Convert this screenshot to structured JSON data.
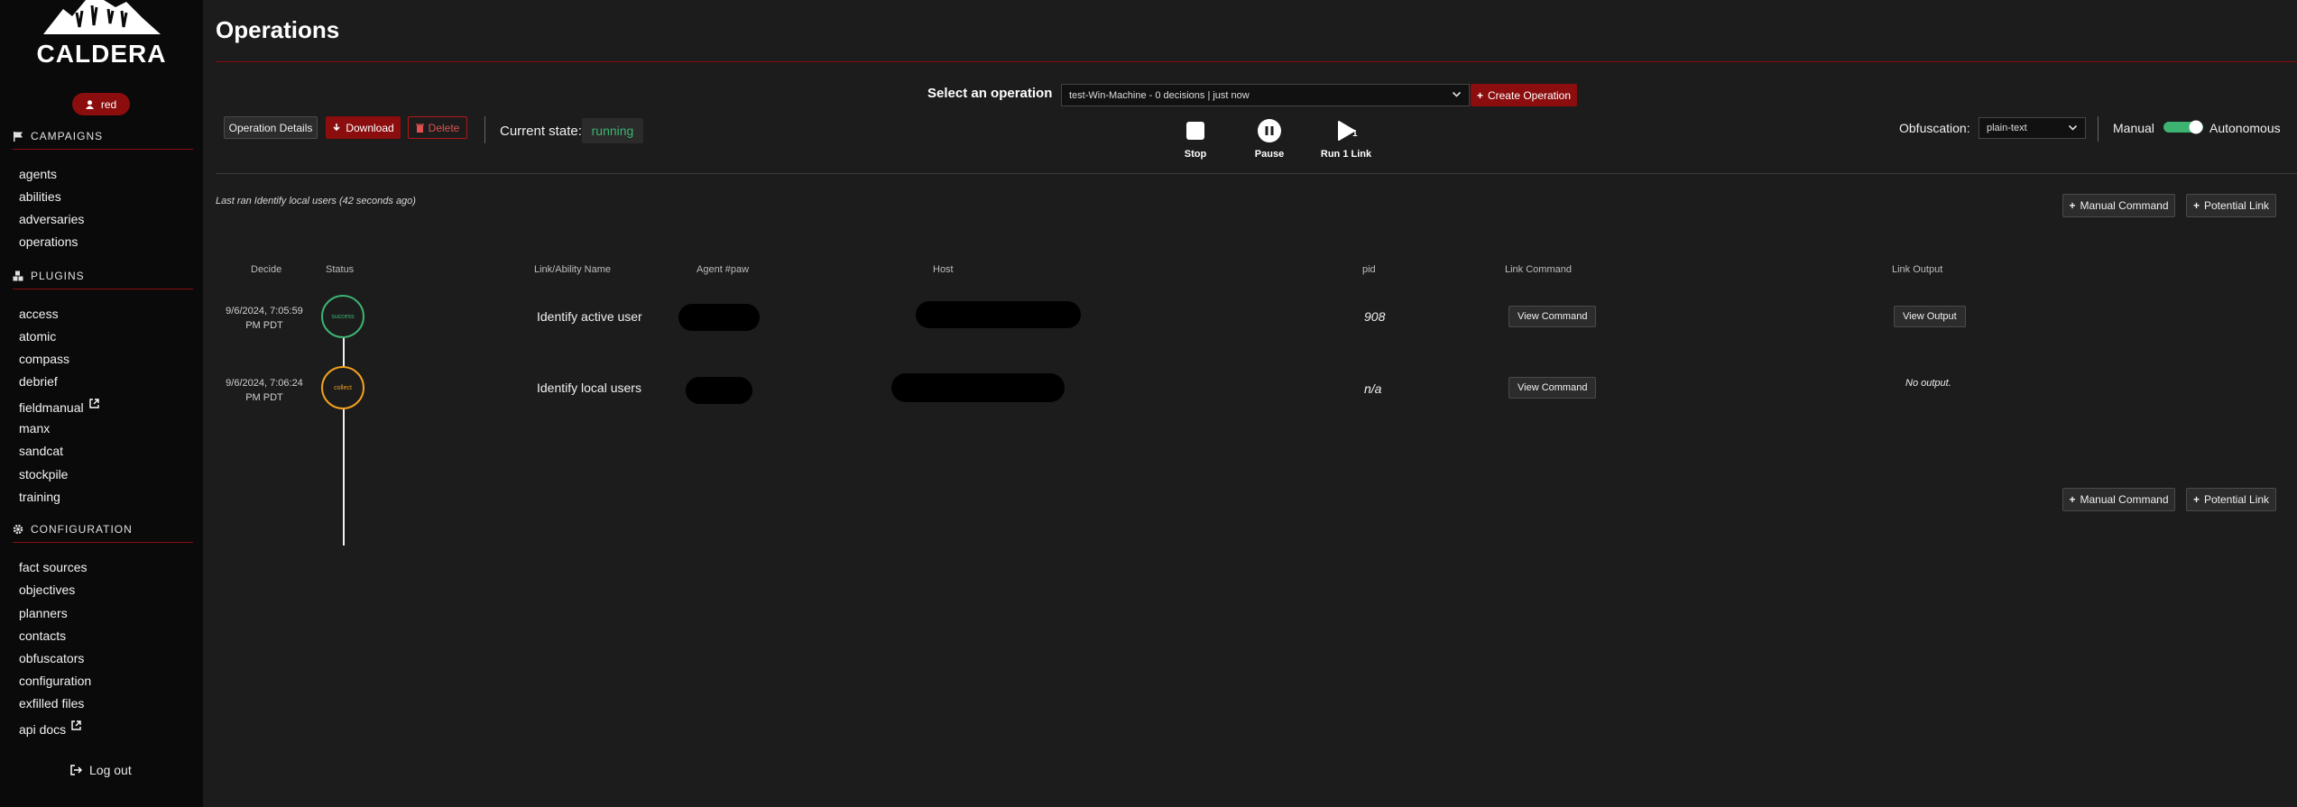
{
  "brand": {
    "name": "CALDERA"
  },
  "user": {
    "label": "red"
  },
  "sidebar": {
    "campaigns": {
      "title": "CAMPAIGNS",
      "items": [
        "agents",
        "abilities",
        "adversaries",
        "operations"
      ]
    },
    "plugins": {
      "title": "PLUGINS",
      "items": [
        "access",
        "atomic",
        "compass",
        "debrief",
        "fieldmanual",
        "manx",
        "sandcat",
        "stockpile",
        "training"
      ]
    },
    "configuration": {
      "title": "CONFIGURATION",
      "items": [
        "fact sources",
        "objectives",
        "planners",
        "contacts",
        "obfuscators",
        "configuration",
        "exfilled files",
        "api docs"
      ]
    },
    "logout": "Log out"
  },
  "page": {
    "title": "Operations"
  },
  "toolbar": {
    "select_label": "Select an operation",
    "operation_selected": "test-Win-Machine - 0 decisions | just now",
    "create_label": "Create Operation",
    "details_label": "Operation Details",
    "download_label": "Download",
    "delete_label": "Delete",
    "state_label": "Current state:",
    "state_value": "running",
    "stop_label": "Stop",
    "pause_label": "Pause",
    "run_label": "Run 1 Link",
    "run_badge": "1",
    "obfuscation_label": "Obfuscation:",
    "obfuscation_value": "plain-text",
    "manual_label": "Manual",
    "autonomous_label": "Autonomous",
    "mode_autonomous": true
  },
  "last_ran": "Last ran Identify local users (42 seconds ago)",
  "actions": {
    "manual_command": "Manual Command",
    "potential_link": "Potential Link"
  },
  "table": {
    "headers": {
      "decide": "Decide",
      "status": "Status",
      "name": "Link/Ability Name",
      "agent": "Agent #paw",
      "host": "Host",
      "pid": "pid",
      "command": "Link Command",
      "output": "Link Output"
    },
    "rows": [
      {
        "date1": "9/6/2024, 7:05:59",
        "date2": "PM PDT",
        "status": "success",
        "status_color": "#3cb371",
        "name": "Identify active user",
        "pid": "908",
        "command_button": "View Command",
        "output_button": "View Output"
      },
      {
        "date1": "9/6/2024, 7:06:24",
        "date2": "PM PDT",
        "status": "collect",
        "status_color": "#f0a020",
        "name": "Identify local users",
        "pid": "n/a",
        "command_button": "View Command",
        "output_text": "No output."
      }
    ]
  },
  "colors": {
    "accent": "#8b0d0d",
    "success": "#3cb371",
    "collect": "#f0a020",
    "toggle_on": "#3cb371"
  }
}
